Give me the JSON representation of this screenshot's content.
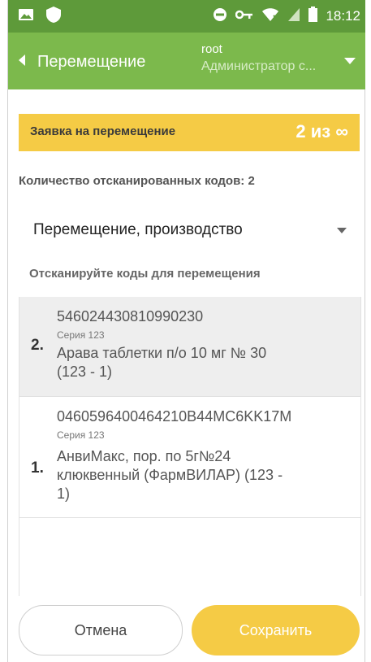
{
  "status_bar": {
    "time": "18:12",
    "icons": [
      "gallery-icon",
      "shield-icon",
      "do-not-disturb-icon",
      "key-icon",
      "wifi-icon",
      "no-sim-icon",
      "battery-icon"
    ]
  },
  "app_bar": {
    "title": "Перемещение",
    "user_name": "root",
    "user_role": "Администратор с..."
  },
  "request": {
    "label": "Заявка на перемещение",
    "count": "2 из ∞"
  },
  "scanned_count_text": "Количество отсканированных кодов: 2",
  "select": {
    "value": "Перемещение, производство"
  },
  "hint": "Отсканируйте коды для перемещения",
  "items": [
    {
      "index": "2.",
      "code": "546024430810990230",
      "series": "Серия 123",
      "name_line1": "Арава таблетки п/о 10 мг № 30",
      "name_line2": "(123 - 1)"
    },
    {
      "index": "1.",
      "code": "0460596400464210B44MC6KK17M",
      "series": "Серия 123",
      "name_line1": "АнвиМакс, пор. по 5г№24",
      "name_line2": "клюквенный (ФармВИЛАР) (123 -",
      "name_line3": "1)"
    }
  ],
  "buttons": {
    "cancel": "Отмена",
    "save": "Сохранить"
  },
  "colors": {
    "status_bar": "#5e9a3a",
    "app_bar": "#7cb94c",
    "accent_yellow": "#f5cb45",
    "selected_row": "#eeeeee"
  }
}
